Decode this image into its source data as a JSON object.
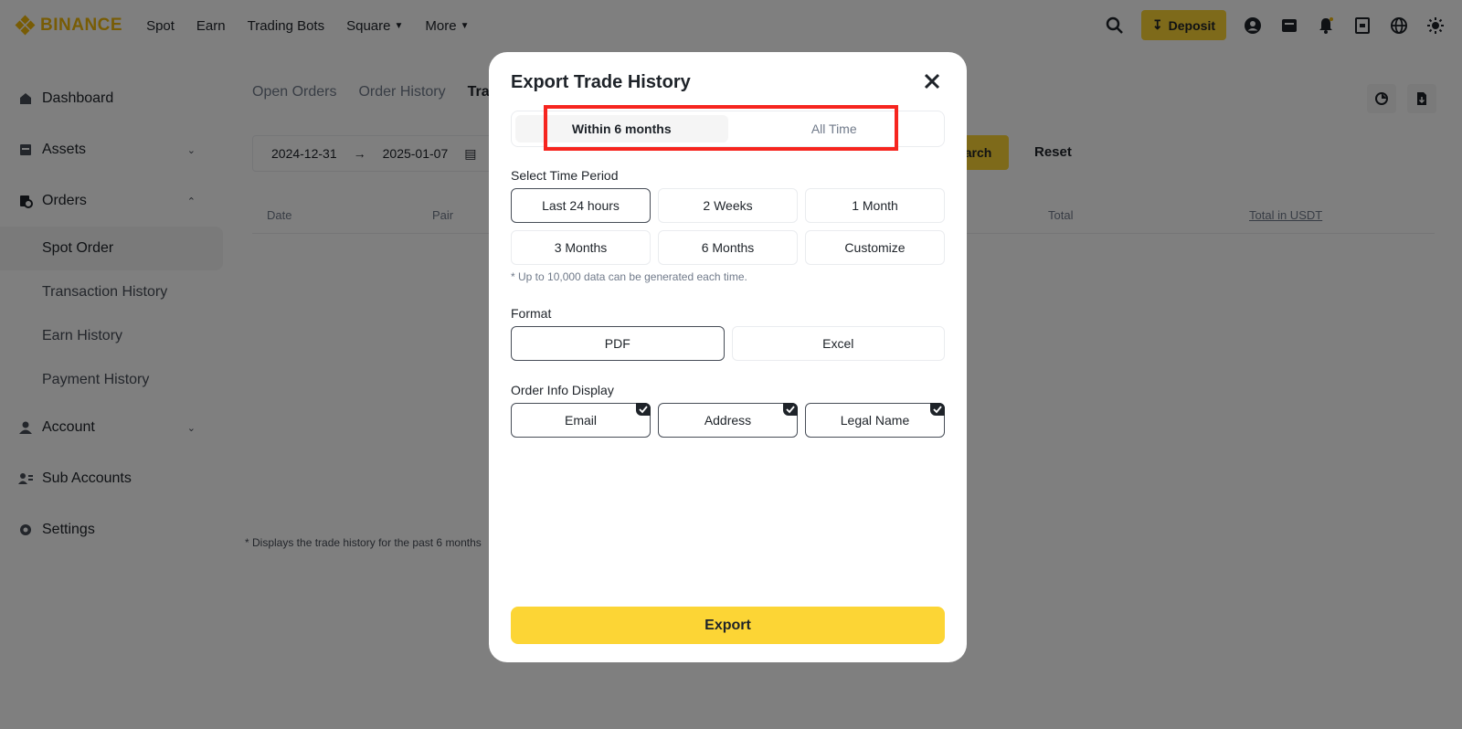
{
  "brand": {
    "name": "BINANCE"
  },
  "topnav": {
    "items": [
      {
        "label": "Spot"
      },
      {
        "label": "Earn"
      },
      {
        "label": "Trading Bots"
      },
      {
        "label": "Square"
      },
      {
        "label": "More"
      }
    ],
    "deposit_label": "Deposit"
  },
  "sidebar": {
    "dashboard": "Dashboard",
    "assets": "Assets",
    "orders": "Orders",
    "spot_order": "Spot Order",
    "transaction_history": "Transaction History",
    "earn_history": "Earn History",
    "payment_history": "Payment History",
    "account": "Account",
    "sub_accounts": "Sub Accounts",
    "settings": "Settings"
  },
  "main": {
    "tabs": [
      "Open Orders",
      "Order History",
      "Tra"
    ],
    "date_from": "2024-12-31",
    "date_to": "2025-01-07",
    "search_label": "Search",
    "reset_label": "Reset",
    "columns": [
      "Date",
      "Pair",
      "Total",
      "Total in USDT"
    ],
    "footnote": "* Displays the trade history for the past 6 months"
  },
  "modal": {
    "title": "Export Trade History",
    "range_tabs": [
      "Within 6 months",
      "All Time"
    ],
    "time_period_label": "Select Time Period",
    "time_options": [
      "Last 24 hours",
      "2 Weeks",
      "1 Month",
      "3 Months",
      "6 Months",
      "Customize"
    ],
    "selected_time": "Last 24 hours",
    "hint": "* Up to 10,000 data can be generated each time.",
    "format_label": "Format",
    "format_options": [
      "PDF",
      "Excel"
    ],
    "selected_format": "PDF",
    "info_label": "Order Info Display",
    "info_options": [
      "Email",
      "Address",
      "Legal Name"
    ],
    "export_label": "Export"
  },
  "colors": {
    "accent": "#fcd535",
    "highlight": "#f6251f"
  }
}
